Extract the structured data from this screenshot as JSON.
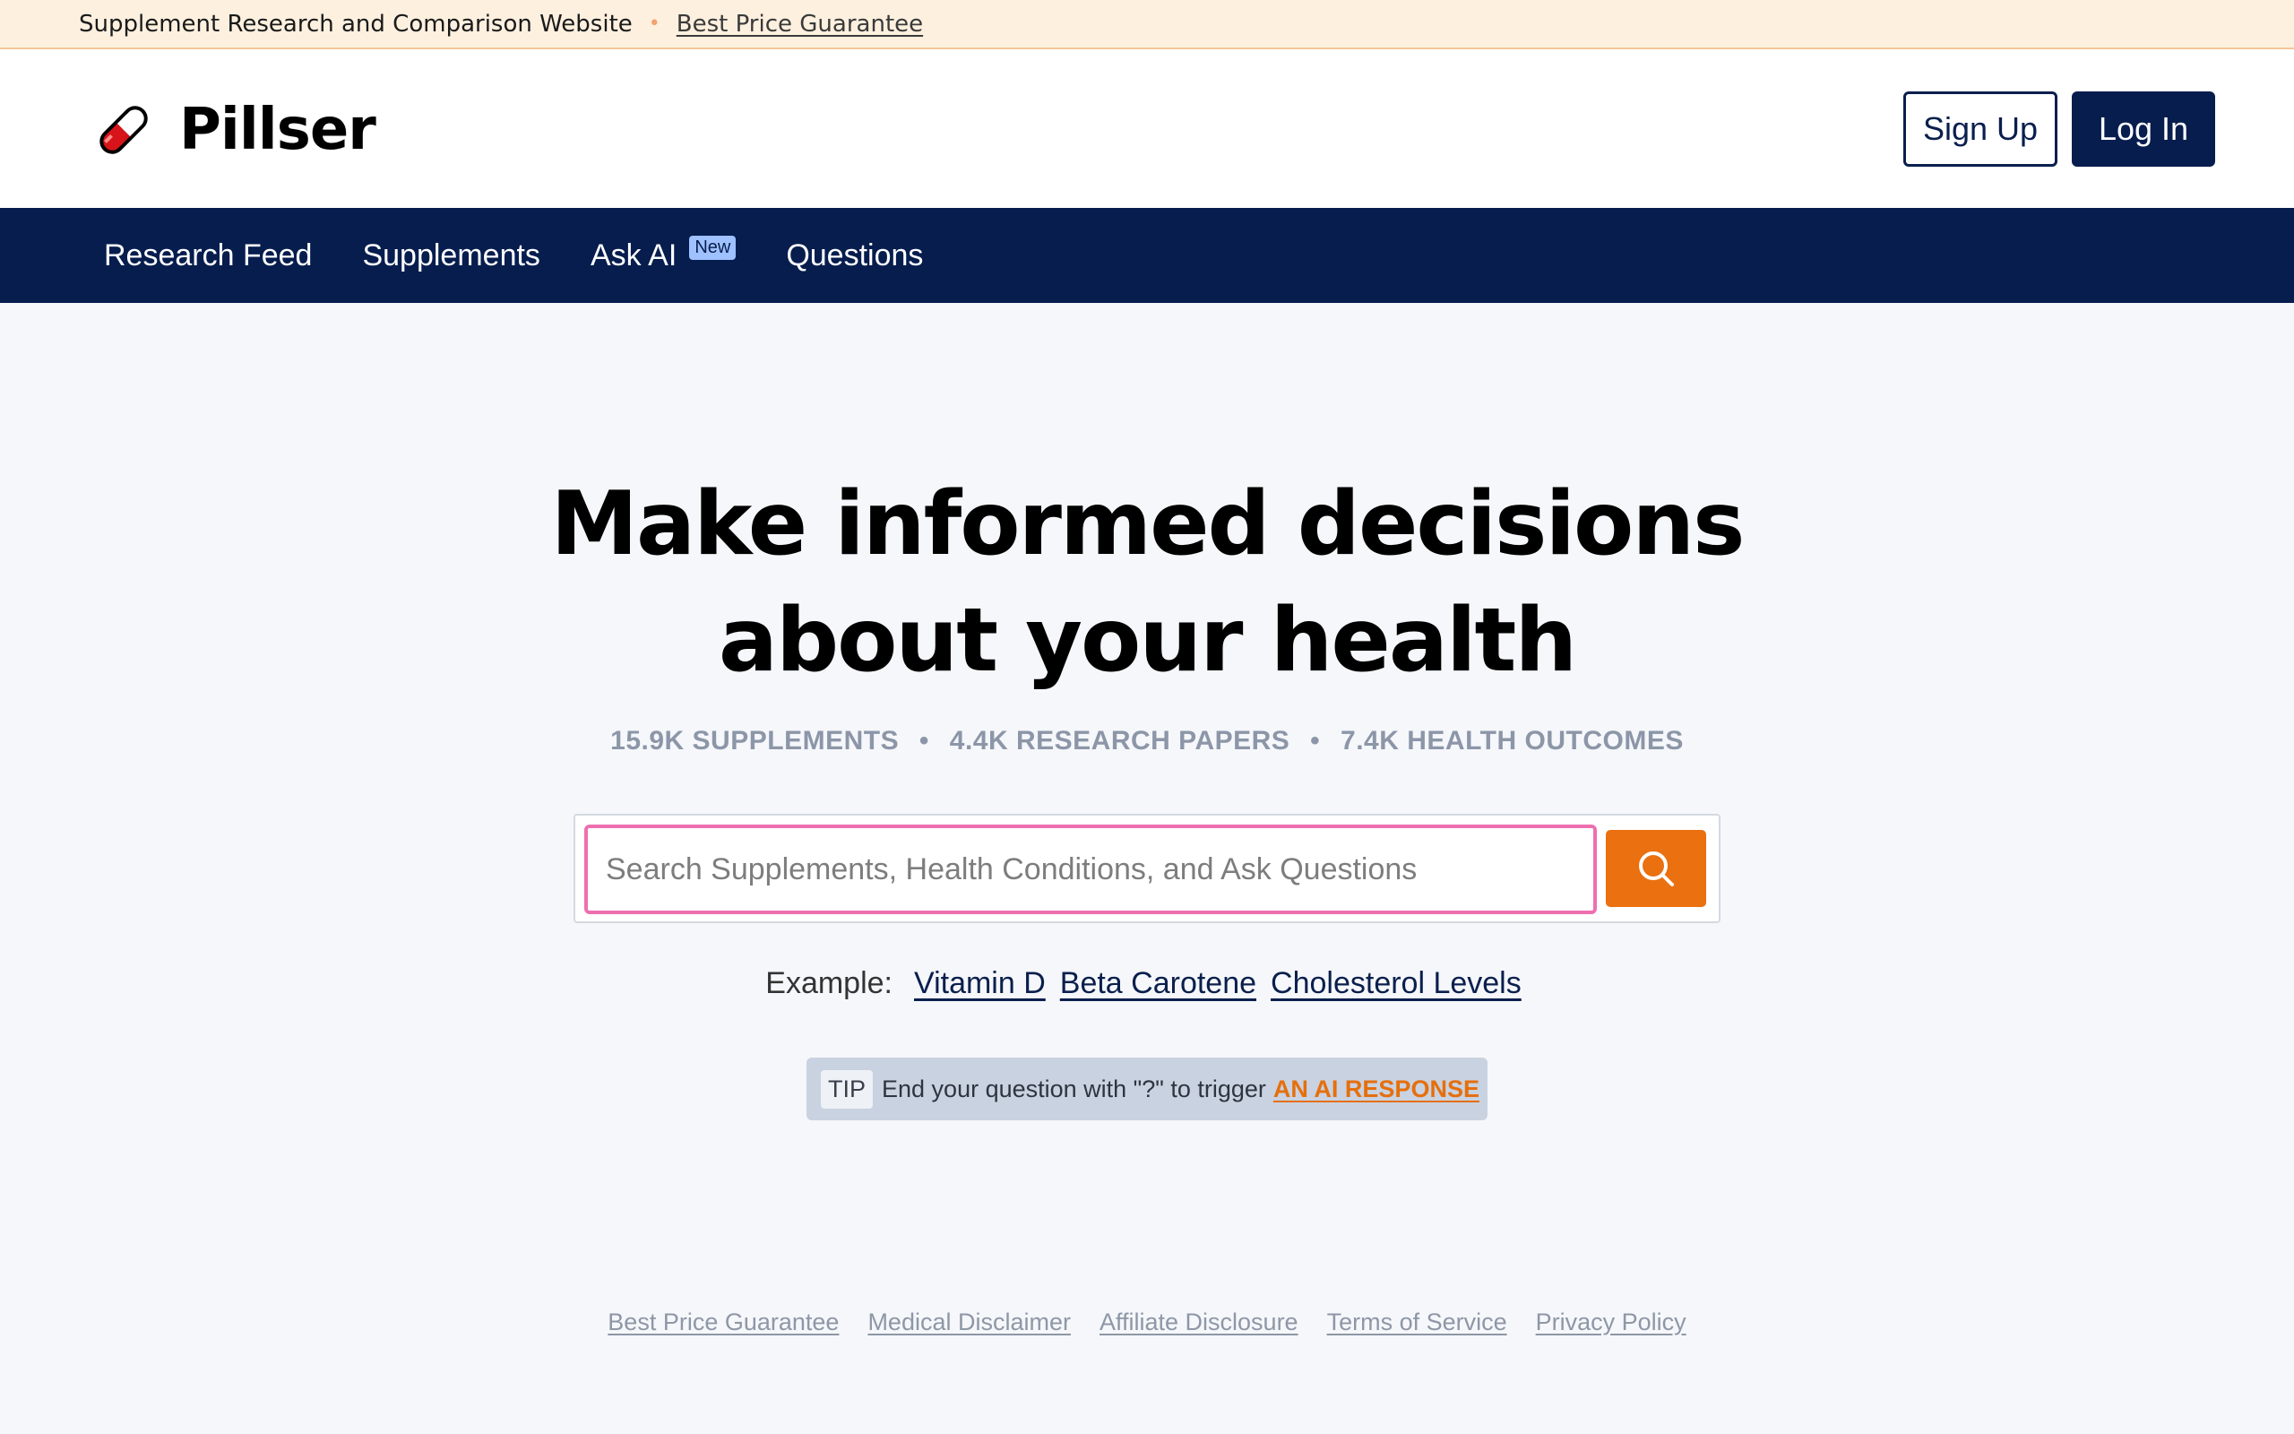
{
  "topbar": {
    "tagline": "Supplement Research and Comparison Website",
    "link": "Best Price Guarantee"
  },
  "header": {
    "logo_text": "Pillser",
    "logo_icon": "pill-icon",
    "signup_label": "Sign Up",
    "login_label": "Log In"
  },
  "nav": {
    "items": [
      {
        "label": "Research Feed"
      },
      {
        "label": "Supplements"
      },
      {
        "label": "Ask AI",
        "badge": "New"
      },
      {
        "label": "Questions"
      }
    ]
  },
  "hero": {
    "title_line1": "Make informed decisions",
    "title_line2": "about your health",
    "stats": [
      "15.9K SUPPLEMENTS",
      "4.4K RESEARCH PAPERS",
      "7.4K HEALTH OUTCOMES"
    ],
    "stats_separator": "•"
  },
  "search": {
    "placeholder": "Search Supplements, Health Conditions, and Ask Questions",
    "value": "",
    "button_icon": "search-icon"
  },
  "examples": {
    "label": "Example:",
    "items": [
      "Vitamin D",
      "Beta Carotene",
      "Cholesterol Levels"
    ]
  },
  "tip": {
    "tag": "TIP",
    "text": "End your question with \"?\" to trigger",
    "link": "AN AI RESPONSE"
  },
  "footer": {
    "links": [
      "Best Price Guarantee",
      "Medical Disclaimer",
      "Affiliate Disclosure",
      "Terms of Service",
      "Privacy Policy"
    ]
  },
  "colors": {
    "navy": "#061d4e",
    "accent_orange": "#ea7010",
    "search_border_pink": "#ee6fb0",
    "topbar_bg": "#fdf0df"
  }
}
